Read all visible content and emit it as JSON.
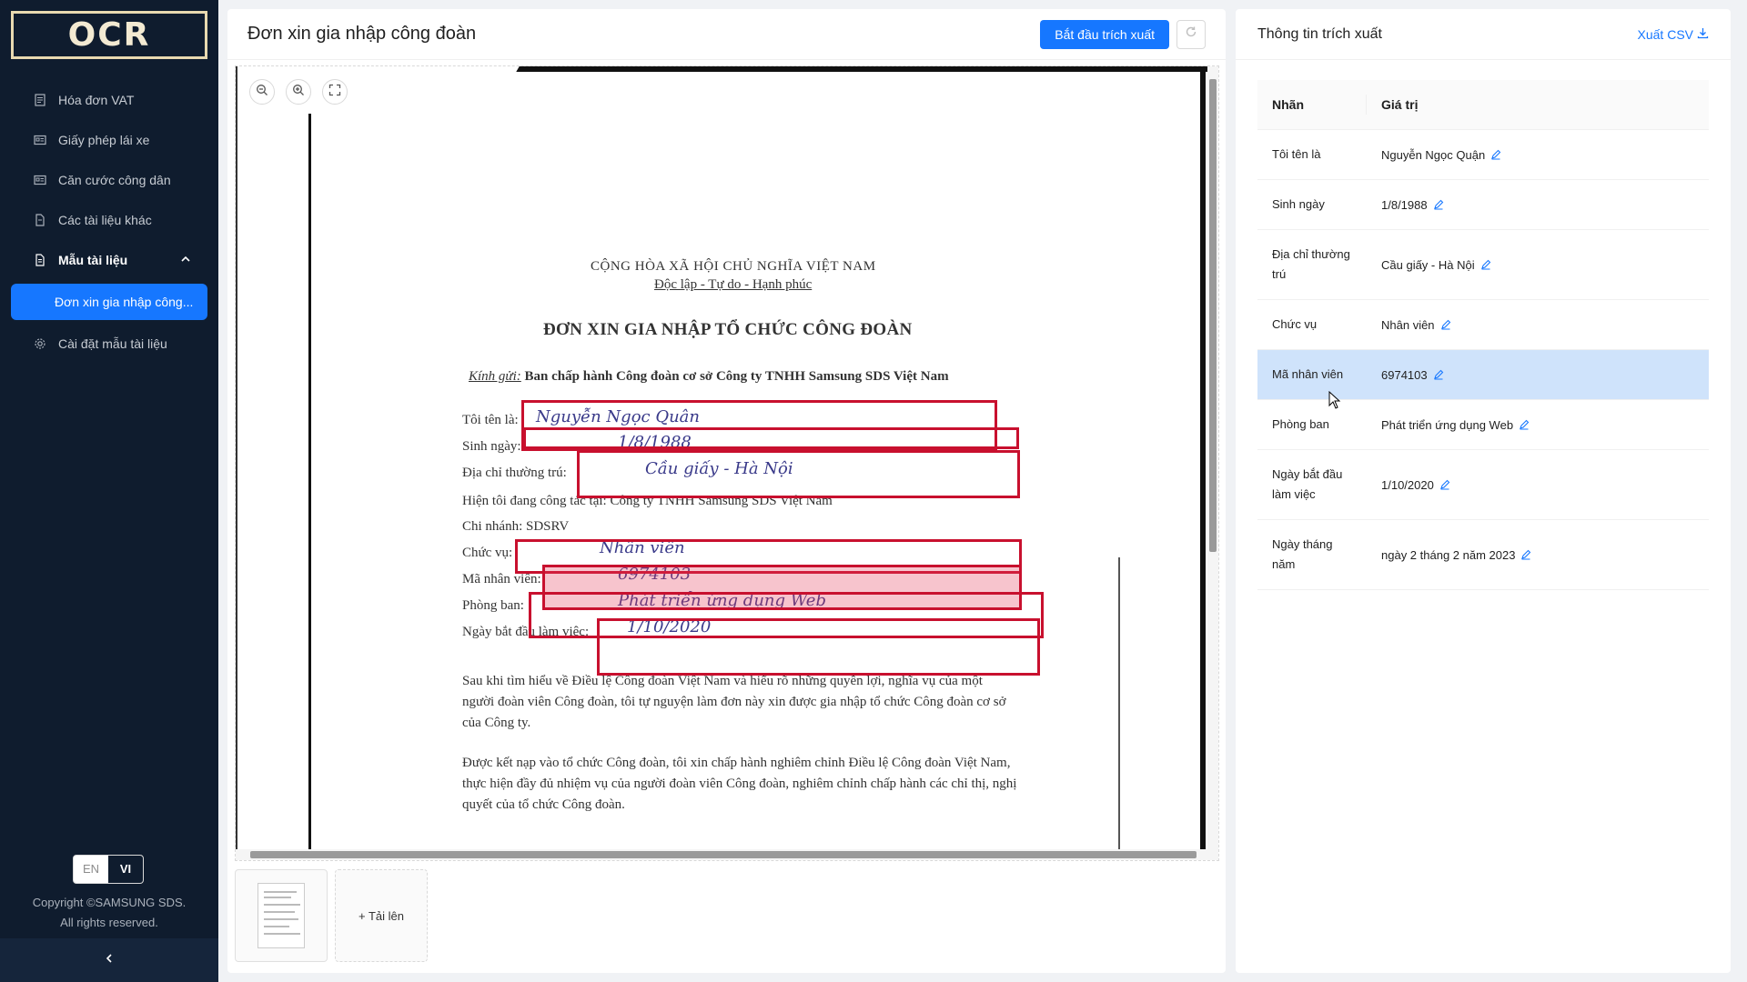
{
  "sidebar": {
    "logo": "OCR",
    "items": [
      {
        "label": "Hóa đơn VAT",
        "icon": "invoice-icon"
      },
      {
        "label": "Giấy phép lái xe",
        "icon": "id-card-icon"
      },
      {
        "label": "Căn cước công dân",
        "icon": "id-card-icon"
      },
      {
        "label": "Các tài liệu khác",
        "icon": "file-icon"
      }
    ],
    "group": {
      "label": "Mẫu tài liệu",
      "icon": "file-text-icon",
      "expanded": true
    },
    "active_sub": "Đơn xin gia nhập công...",
    "settings": {
      "label": "Cài đặt mẫu tài liệu",
      "icon": "gear-icon"
    },
    "lang": {
      "en": "EN",
      "vi": "VI",
      "selected": "VI"
    },
    "copyright_line1": "Copyright ©SAMSUNG SDS.",
    "copyright_line2": "All rights reserved."
  },
  "main": {
    "title": "Đơn xin gia nhập công đoàn",
    "start_button": "Bắt đầu trích xuất",
    "upload_label": "+ Tải lên"
  },
  "document": {
    "header1": "CỘNG HÒA XÃ HỘI CHỦ NGHĨA VIỆT NAM",
    "header2": "Độc lập - Tự do - Hạnh phúc",
    "title": "ĐƠN XIN GIA NHẬP TỔ CHỨC CÔNG ĐOÀN",
    "kinh_gui": "Kính gửi:",
    "recipient": " Ban chấp hành Công đoàn cơ sở Công ty TNHH Samsung SDS Việt Nam",
    "f1": "Tôi tên là:",
    "f2": "Sinh ngày:",
    "f3": "Địa chỉ thường trú:",
    "f4": "Hiện tôi đang công tác tại: Công ty TNHH Samsung SDS Việt Nam",
    "f5": "Chi nhánh: SDSRV",
    "f6": "Chức vụ:",
    "f7": "Mã nhân viên:",
    "f8": "Phòng ban:",
    "f9": "Ngày bắt đầu làm việc:",
    "h1": "Nguyễn Ngọc Quân",
    "h2": "1/8/1988",
    "h3": "Cầu giấy - Hà Nội",
    "h6": "Nhân viên",
    "h7": "6974103",
    "h8": "Phát triển ứng dụng Web",
    "h9": "1/10/2020",
    "para1": "Sau khi tìm hiểu về Điều lệ Công đoàn Việt Nam và hiểu rõ những quyền lợi, nghĩa vụ của một người đoàn viên Công đoàn, tôi tự nguyện làm đơn này xin được gia nhập tổ chức Công đoàn cơ sở của Công ty.",
    "para2": "Được kết nạp vào tổ chức Công đoàn, tôi xin chấp hành nghiêm chỉnh Điều lệ Công đoàn Việt Nam, thực hiện đầy đủ nhiệm vụ của người đoàn viên Công đoàn, nghiêm chỉnh chấp hành các chỉ thị, nghị quyết của tổ chức Công đoàn."
  },
  "info": {
    "title": "Thông tin trích xuất",
    "export": "Xuất CSV",
    "col_label": "Nhãn",
    "col_value": "Giá trị",
    "rows": [
      {
        "label": "Tôi tên là",
        "value": "Nguyễn Ngọc Quận"
      },
      {
        "label": "Sinh ngày",
        "value": "1/8/1988"
      },
      {
        "label": "Địa chỉ thường trú",
        "value": "Cầu giấy - Hà Nội"
      },
      {
        "label": "Chức vụ",
        "value": "Nhân viên"
      },
      {
        "label": "Mã nhân viên",
        "value": "6974103",
        "selected": true
      },
      {
        "label": "Phòng ban",
        "value": "Phát triển ứng dụng Web"
      },
      {
        "label": "Ngày bắt đầu làm việc",
        "value": "1/10/2020"
      },
      {
        "label": "Ngày tháng năm",
        "value": "ngày 2 tháng 2 năm 2023"
      }
    ]
  },
  "colors": {
    "primary": "#1677ff",
    "sidebar_bg": "#0f1c2e",
    "box": "#c8102e",
    "selected_row": "#cfe3fb"
  }
}
